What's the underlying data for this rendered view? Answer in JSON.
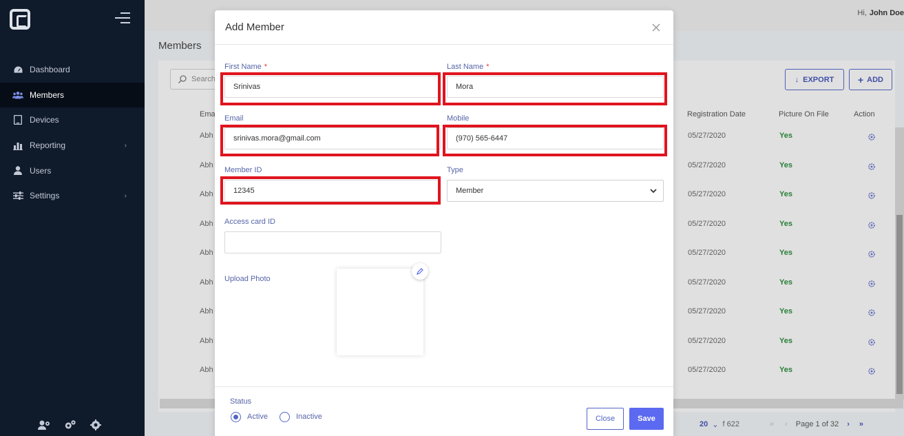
{
  "user": {
    "greeting": "Hi,",
    "name": "John Doe"
  },
  "sidebar": {
    "items": [
      {
        "label": "Dashboard",
        "icon": "dashboard-icon"
      },
      {
        "label": "Members",
        "icon": "users-group-icon"
      },
      {
        "label": "Devices",
        "icon": "tablet-icon"
      },
      {
        "label": "Reporting",
        "icon": "bar-chart-icon"
      },
      {
        "label": "Users",
        "icon": "user-icon"
      },
      {
        "label": "Settings",
        "icon": "sliders-icon"
      }
    ],
    "active": "Members"
  },
  "page": {
    "title": "Members",
    "search_placeholder": "Search",
    "export_label": "EXPORT",
    "add_label": "ADD",
    "columns": [
      "Email",
      "Registration Date",
      "Picture On File",
      "Action"
    ],
    "row_email_prefix": "Abh",
    "rows": [
      {
        "date": "05/27/2020",
        "picture": "Yes"
      },
      {
        "date": "05/27/2020",
        "picture": "Yes"
      },
      {
        "date": "05/27/2020",
        "picture": "Yes"
      },
      {
        "date": "05/27/2020",
        "picture": "Yes"
      },
      {
        "date": "05/27/2020",
        "picture": "Yes"
      },
      {
        "date": "05/27/2020",
        "picture": "Yes"
      },
      {
        "date": "05/27/2020",
        "picture": "Yes"
      },
      {
        "date": "05/27/2020",
        "picture": "Yes"
      },
      {
        "date": "05/27/2020",
        "picture": "Yes"
      }
    ],
    "pager": {
      "per_page": "20",
      "total": "f 622",
      "page_text": "Page 1 of 32"
    }
  },
  "modal": {
    "title": "Add Member",
    "first_name": {
      "label": "First Name",
      "value": "Srinivas"
    },
    "last_name": {
      "label": "Last Name",
      "value": "Mora"
    },
    "email": {
      "label": "Email",
      "value": "srinivas.mora@gmail.com"
    },
    "mobile": {
      "label": "Mobile",
      "value": "(970) 565-6447"
    },
    "member_id": {
      "label": "Member ID",
      "value": "12345"
    },
    "type": {
      "label": "Type",
      "value": "Member"
    },
    "access_card": {
      "label": "Access card ID",
      "value": ""
    },
    "upload_photo_label": "Upload Photo",
    "status": {
      "label": "Status",
      "active": "Active",
      "inactive": "Inactive",
      "selected": "Active"
    },
    "close_label": "Close",
    "save_label": "Save",
    "required_mark": "*"
  },
  "colors": {
    "accent": "#5b6af0",
    "highlight": "#e0141e",
    "sidebar": "#0f1a2b",
    "yes": "#2d8a3d"
  }
}
